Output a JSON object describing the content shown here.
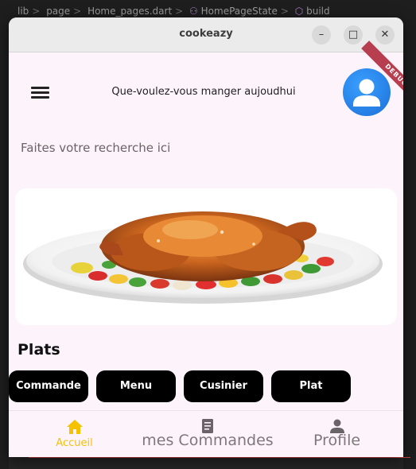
{
  "ide": {
    "breadcrumb": [
      "lib",
      "page",
      "Home_pages.dart",
      "HomePageState",
      "build"
    ]
  },
  "window": {
    "title": "cookeazy",
    "minimize": "–",
    "maximize": "□",
    "close": "✕"
  },
  "debug_banner": "DEBUG",
  "header": {
    "title": "Que-voulez-vous manger aujoudhui"
  },
  "search": {
    "value": "Faites votre recherche ici"
  },
  "section": {
    "title": "Plats"
  },
  "categories": [
    "Commande",
    "Menu",
    "Cusinier",
    "Plat"
  ],
  "nav": {
    "items": [
      {
        "label": "Accueil",
        "icon": "home-icon",
        "active": true
      },
      {
        "label": "mes Commandes",
        "icon": "receipt-icon",
        "active": false
      },
      {
        "label": "Profile",
        "icon": "person-icon",
        "active": false
      }
    ]
  },
  "colors": {
    "accent": "#f5c200",
    "chip_bg": "#000000",
    "page_bg": "#fdf4fb",
    "avatar": "#1c74e9"
  }
}
